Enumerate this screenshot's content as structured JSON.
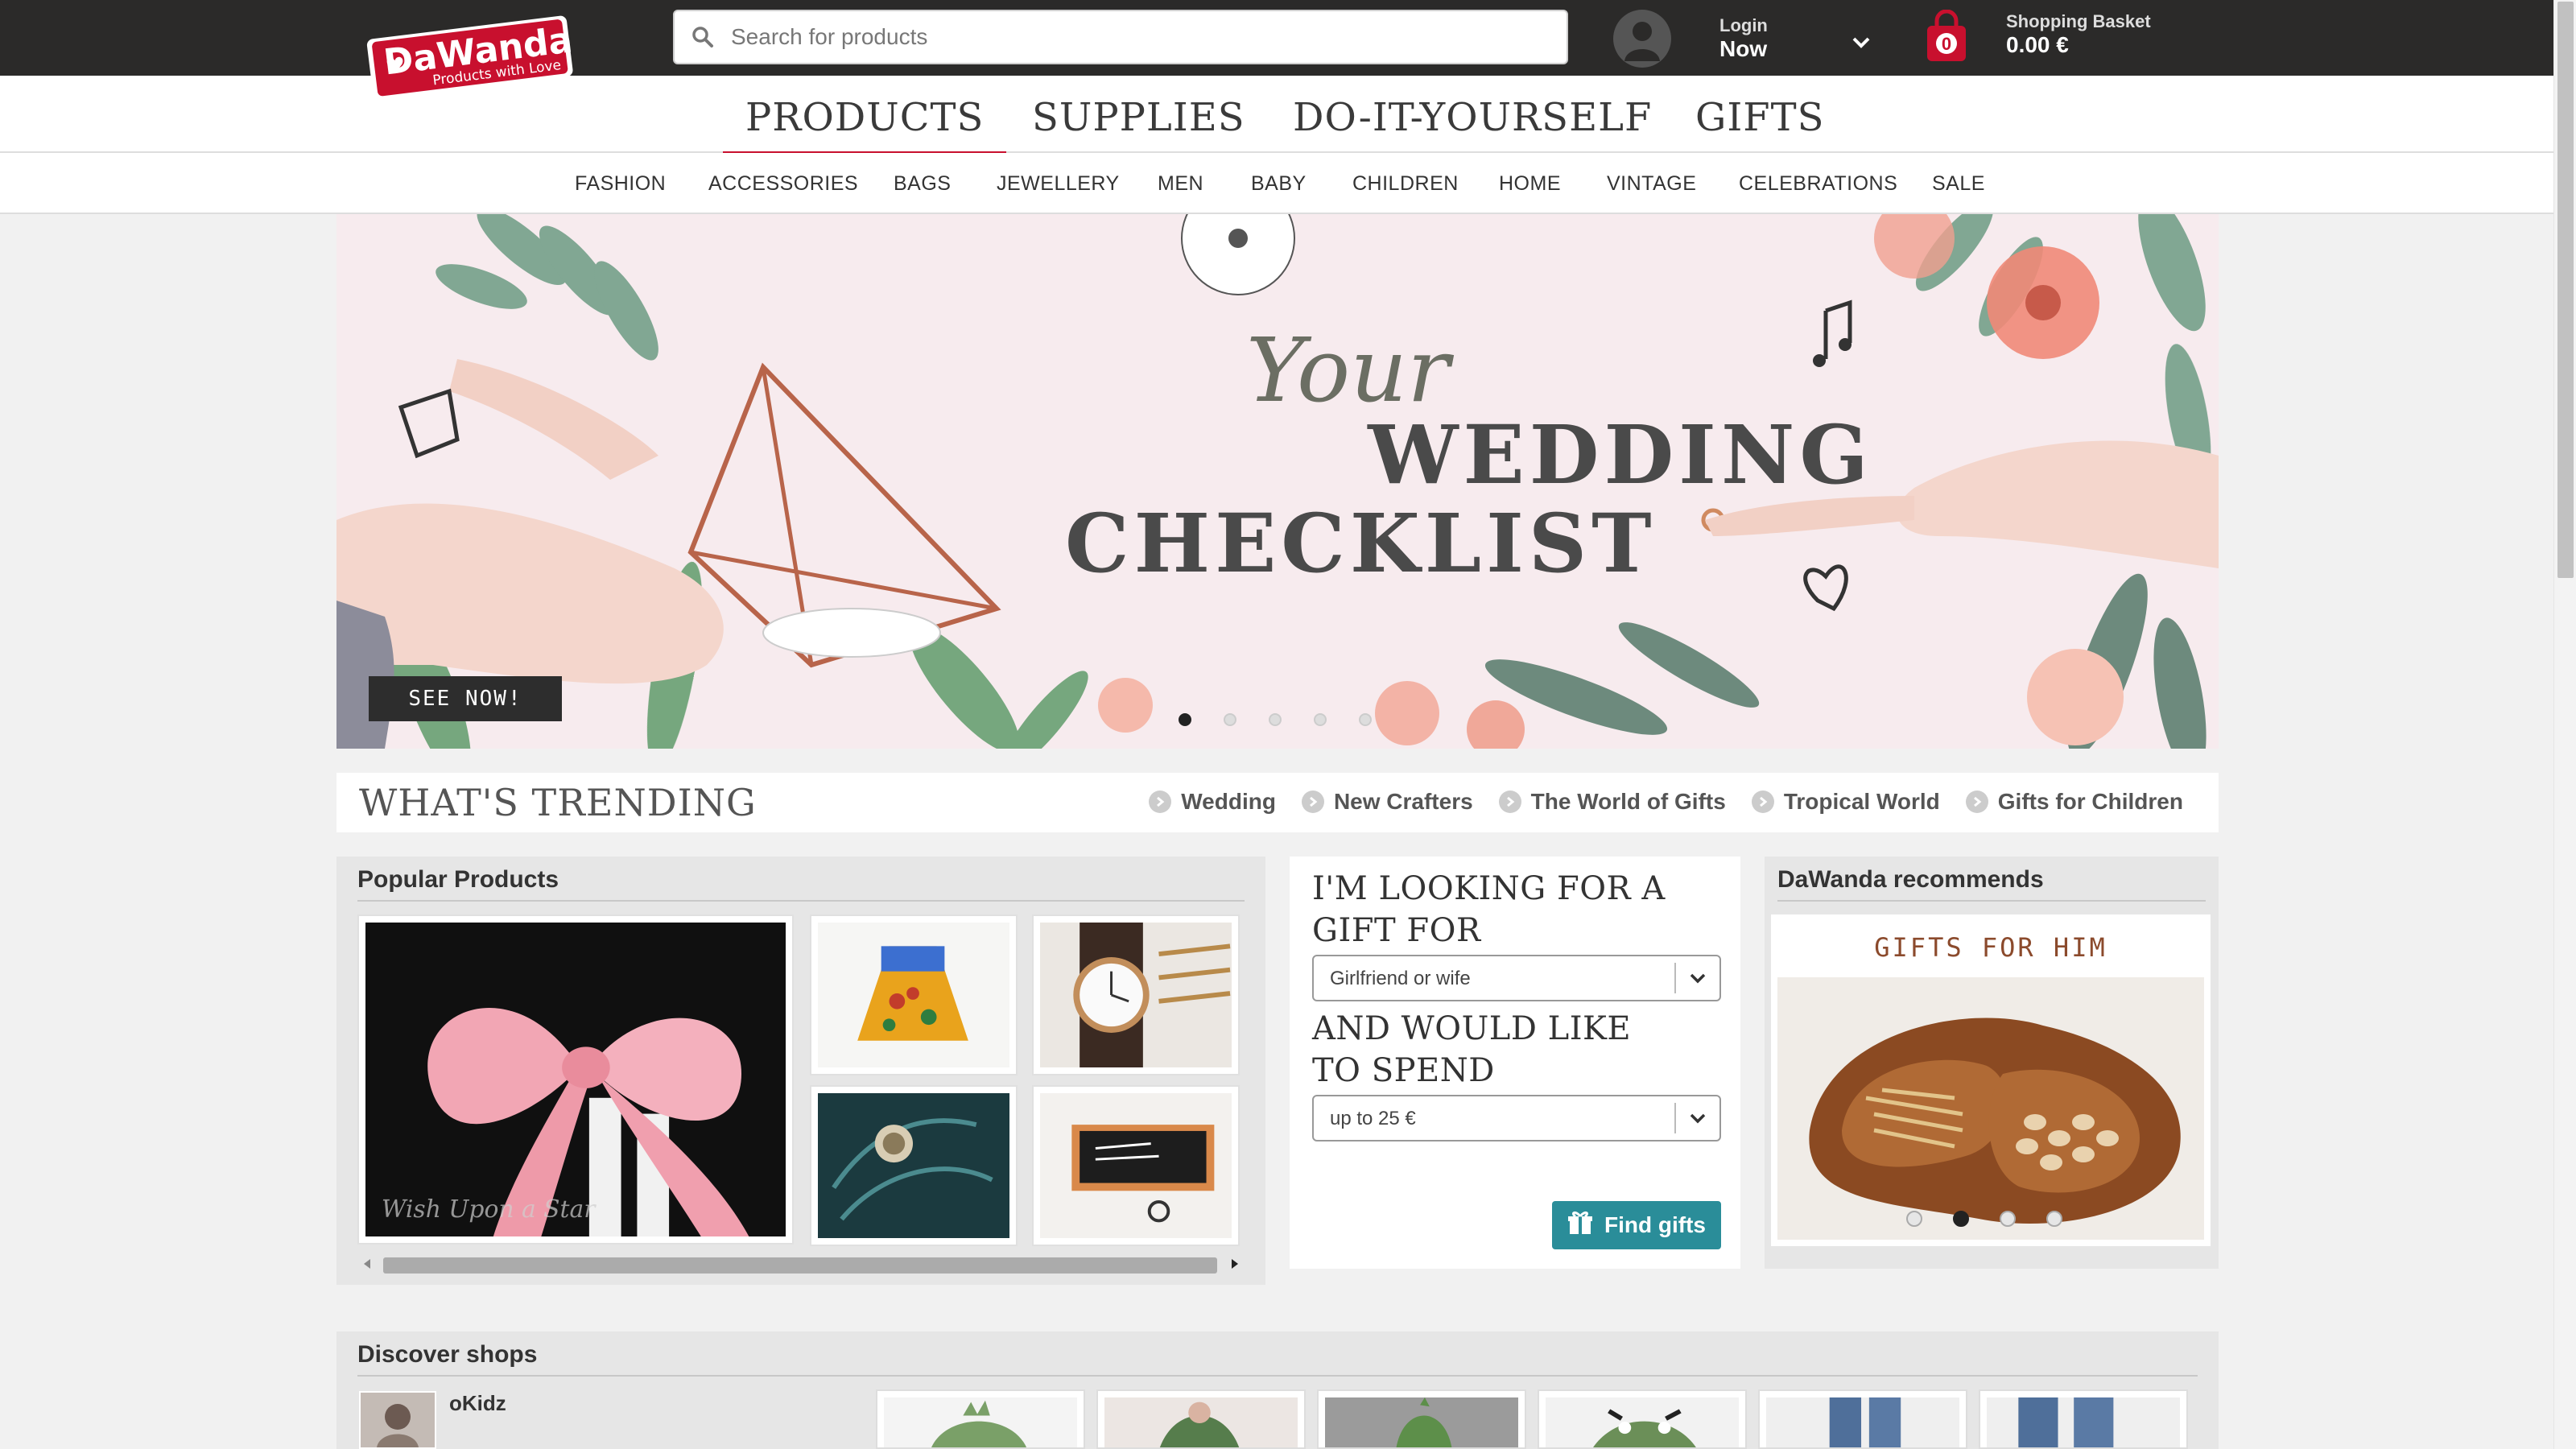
{
  "header": {
    "logo_text": "DaWanda",
    "logo_tagline": "Products with Love",
    "search_placeholder": "Search for products",
    "login_line1": "Login",
    "login_line2": "Now",
    "basket_count": "0",
    "basket_label": "Shopping Basket",
    "basket_total": "0.00 €"
  },
  "main_nav": {
    "tabs": [
      "PRODUCTS",
      "SUPPLIES",
      "DO-IT-YOURSELF",
      "GIFTS"
    ],
    "active": "PRODUCTS"
  },
  "sub_nav": {
    "items": [
      "FASHION",
      "ACCESSORIES",
      "BAGS",
      "JEWELLERY",
      "MEN",
      "BABY",
      "CHILDREN",
      "HOME",
      "VINTAGE",
      "CELEBRATIONS",
      "SALE"
    ]
  },
  "hero": {
    "line1": "Your",
    "line2": "WEDDING",
    "line3": "CHECKLIST",
    "cta": "SEE NOW!",
    "slide_count": 5,
    "active_slide": 1
  },
  "trending": {
    "title": "WHAT'S TRENDING",
    "links": [
      "Wedding",
      "New Crafters",
      "The World of Gifts",
      "Tropical World",
      "Gifts for Children"
    ]
  },
  "popular": {
    "title": "Popular Products",
    "watermark": "Wish Upon a Star"
  },
  "gift_finder": {
    "question1": "I'M LOOKING FOR A GIFT FOR",
    "recipient": "Girlfriend or wife",
    "question2": "AND WOULD LIKE TO SPEND",
    "budget": "up to 25 €",
    "button": "Find gifts"
  },
  "recommends": {
    "title": "DaWanda recommends",
    "card_label": "GIFTS FOR HIM",
    "slide_count": 4,
    "active_slide": 2
  },
  "discover": {
    "title": "Discover shops",
    "shop_name": "oKidz"
  },
  "colors": {
    "topbar": "#2b2a29",
    "brand_red": "#c8102e",
    "find_button": "#2a8d99"
  }
}
